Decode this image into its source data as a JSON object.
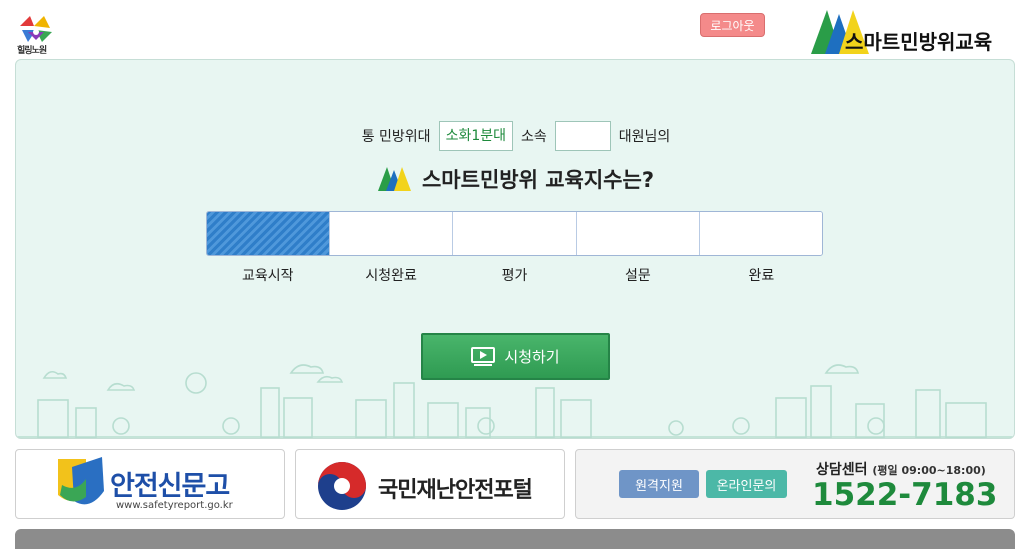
{
  "header": {
    "city_logo_text": "힐링노원",
    "logout_label": "로그아웃",
    "brand_text": "스마트민방위교육"
  },
  "intro": {
    "prefix": "통 민방위대",
    "unit": "소화1분대",
    "belong_label": "소속",
    "belong_value": "",
    "suffix": "대원님의"
  },
  "title": "스마트민방위 교육지수는?",
  "progress": {
    "completed_fraction": 0.2,
    "steps": [
      "교육시작",
      "시청완료",
      "평가",
      "설문",
      "완료"
    ]
  },
  "watch_button": {
    "label": "시청하기"
  },
  "banners": {
    "safety_report": {
      "title": "안전신문고",
      "url": "www.safetyreport.go.kr"
    },
    "disaster_portal": {
      "title": "국민재난안전포털"
    },
    "support": {
      "remote_label": "원격지원",
      "online_label": "온라인문의",
      "center_label": "상담센터",
      "hours": "(평일 09:00~18:00)",
      "phone": "1522-7183"
    }
  },
  "colors": {
    "accent_green": "#1e8a3c",
    "progress_blue": "#2f7ec9",
    "panel_bg": "#e8f6f2",
    "logout_red": "#f48a8a"
  }
}
